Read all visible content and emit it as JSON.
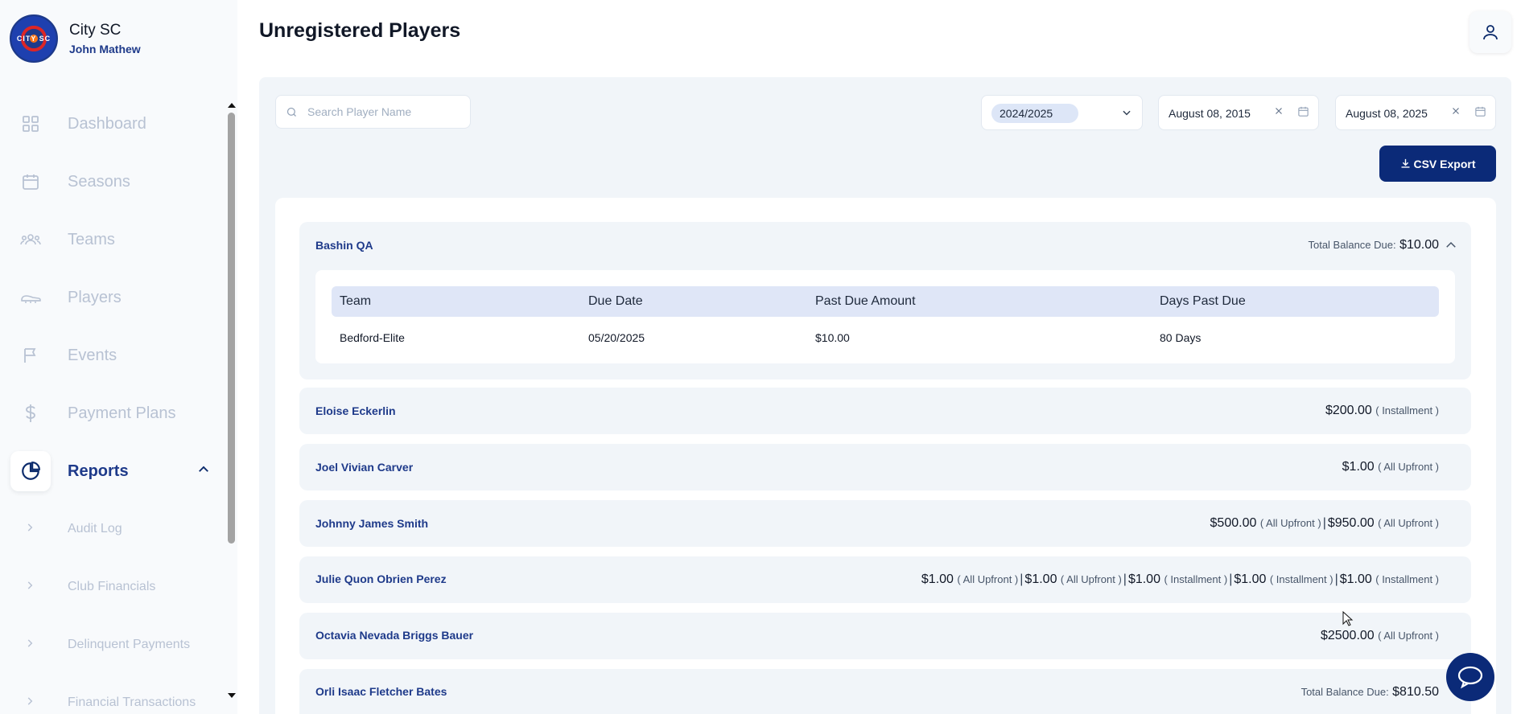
{
  "club": {
    "name": "City SC",
    "user": "John Mathew",
    "logo_text": "CITY SC"
  },
  "nav": {
    "dashboard": "Dashboard",
    "seasons": "Seasons",
    "teams": "Teams",
    "players": "Players",
    "events": "Events",
    "payment_plans": "Payment Plans",
    "reports": "Reports",
    "sub": {
      "audit_log": "Audit Log",
      "club_financials": "Club Financials",
      "delinquent_payments": "Delinquent Payments",
      "financial_transactions": "Financial Transactions"
    }
  },
  "page": {
    "title": "Unregistered Players"
  },
  "filters": {
    "search_placeholder": "Search Player Name",
    "season": "2024/2025",
    "date_from": "August 08, 2015",
    "date_to": "August 08, 2025",
    "export_label": "CSV Export"
  },
  "players": [
    {
      "name": "Bashin QA",
      "total_label": "Total Balance Due:",
      "total": "$10.00",
      "expanded": true,
      "table": {
        "headers": [
          "Team",
          "Due Date",
          "Past Due Amount",
          "Days Past Due"
        ],
        "rows": [
          [
            "Bedford-Elite",
            "05/20/2025",
            "$10.00",
            "80 Days"
          ]
        ]
      }
    },
    {
      "name": "Eloise Eckerlin",
      "amounts": [
        {
          "amount": "$200.00",
          "type": "( Installment )"
        }
      ]
    },
    {
      "name": "Joel Vivian Carver",
      "amounts": [
        {
          "amount": "$1.00",
          "type": "( All Upfront )"
        }
      ]
    },
    {
      "name": "Johnny James Smith",
      "amounts": [
        {
          "amount": "$500.00",
          "type": "( All Upfront )"
        },
        {
          "amount": "$950.00",
          "type": "( All Upfront )"
        }
      ]
    },
    {
      "name": "Julie Quon Obrien Perez",
      "amounts": [
        {
          "amount": "$1.00",
          "type": "( All Upfront )"
        },
        {
          "amount": "$1.00",
          "type": "( All Upfront )"
        },
        {
          "amount": "$1.00",
          "type": "( Installment )"
        },
        {
          "amount": "$1.00",
          "type": "( Installment )"
        },
        {
          "amount": "$1.00",
          "type": "( Installment )"
        }
      ]
    },
    {
      "name": "Octavia Nevada Briggs Bauer",
      "amounts": [
        {
          "amount": "$2500.00",
          "type": "( All Upfront )"
        }
      ]
    },
    {
      "name": "Orli Isaac Fletcher Bates",
      "total_label": "Total Balance Due:",
      "total": "$810.50"
    }
  ],
  "colors": {
    "brand": "#0b2a78",
    "nav_inactive": "#b8c2d3",
    "panel_bg": "#f1f5f9"
  },
  "icons": [
    "dashboard-icon",
    "calendar-icon",
    "teams-icon",
    "players-icon",
    "flag-icon",
    "dollar-icon",
    "pie-chart-icon",
    "chevron-up-icon",
    "chevron-right-icon",
    "search-icon",
    "chevron-down-icon",
    "close-icon",
    "calendar-icon",
    "download-icon",
    "user-icon",
    "chat-icon"
  ]
}
